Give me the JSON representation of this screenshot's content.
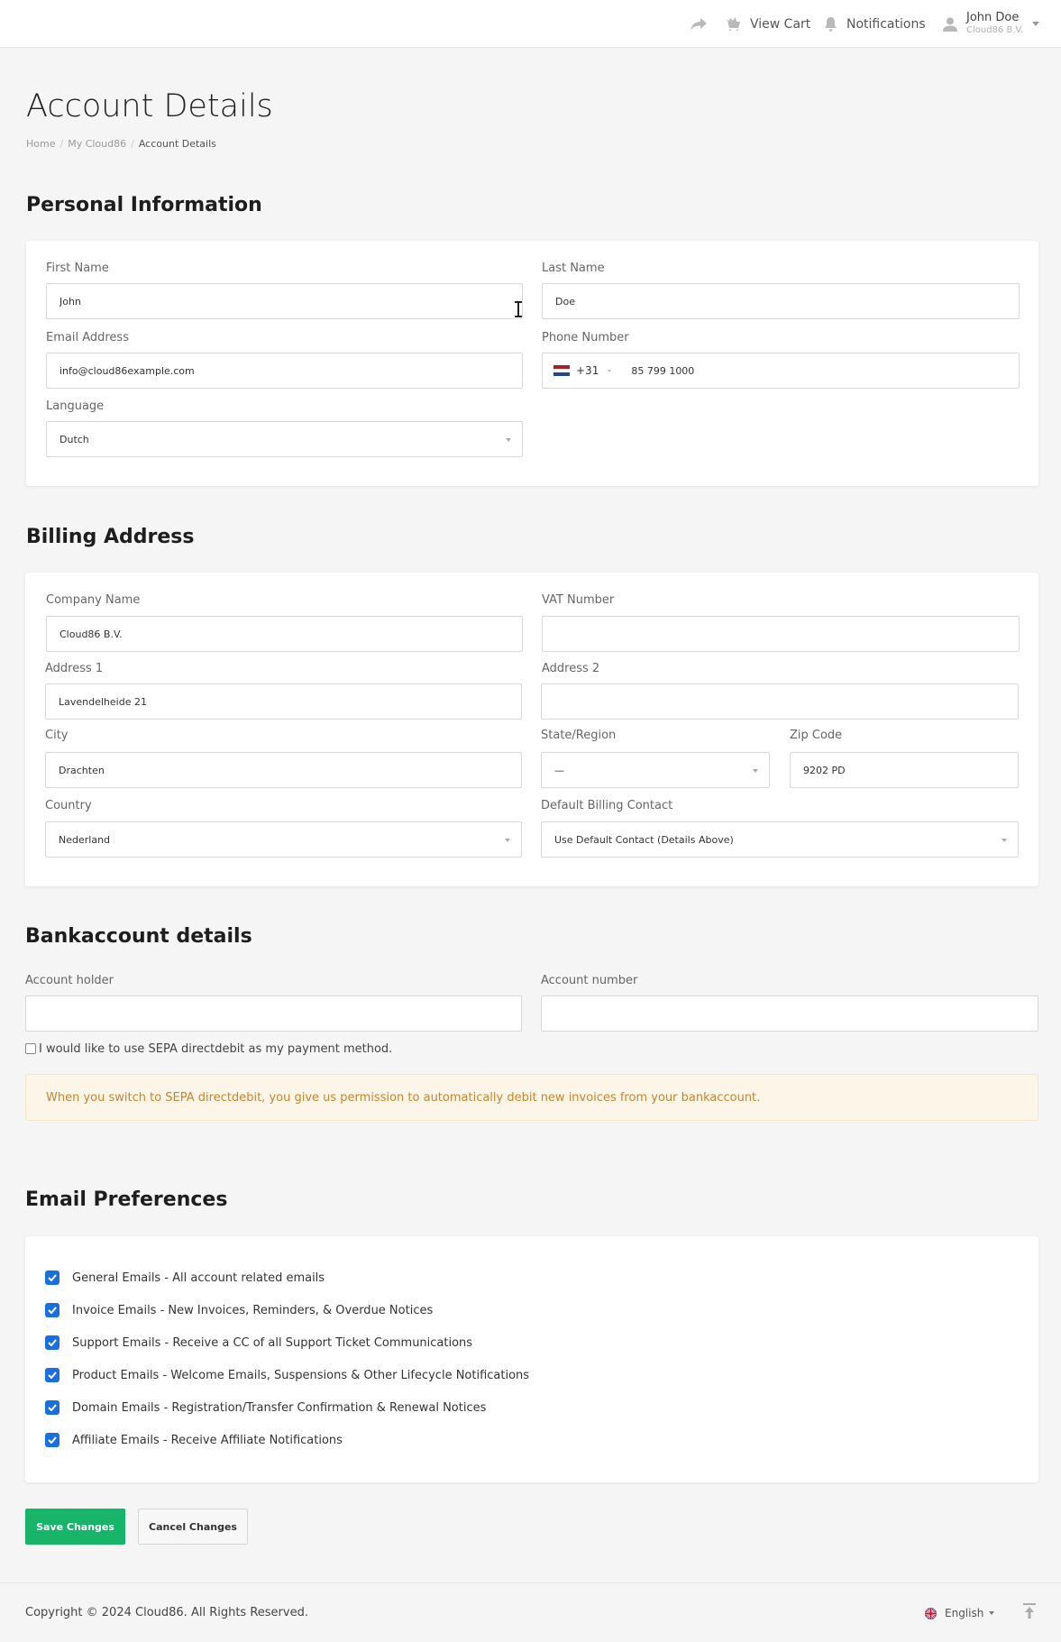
{
  "header": {
    "cart_label": "View Cart",
    "notifications_label": "Notifications",
    "user_name": "John Doe",
    "user_company": "Cloud86 B.V."
  },
  "page": {
    "title": "Account Details",
    "breadcrumb": [
      "Home",
      "My Cloud86",
      "Account Details"
    ]
  },
  "personal": {
    "heading": "Personal Information",
    "first_name_label": "First Name",
    "first_name": "John",
    "last_name_label": "Last Name",
    "last_name": "Doe",
    "email_label": "Email Address",
    "email": "info@cloud86example.com",
    "phone_label": "Phone Number",
    "phone_code": "+31",
    "phone_number": "85 799 1000",
    "language_label": "Language",
    "language": "Dutch"
  },
  "billing": {
    "heading": "Billing Address",
    "company_label": "Company Name",
    "company": "Cloud86 B.V.",
    "vat_label": "VAT Number",
    "vat": "",
    "address1_label": "Address 1",
    "address1": "Lavendelheide 21",
    "address2_label": "Address 2",
    "address2": "",
    "city_label": "City",
    "city": "Drachten",
    "state_label": "State/Region",
    "state": "—",
    "zip_label": "Zip Code",
    "zip": "9202 PD",
    "country_label": "Country",
    "country": "Nederland",
    "contact_label": "Default Billing Contact",
    "contact": "Use Default Contact (Details Above)"
  },
  "bank": {
    "heading": "Bankaccount details",
    "holder_label": "Account holder",
    "holder": "",
    "number_label": "Account number",
    "number": "",
    "sepa_label": "I would like to use SEPA directdebit as my payment method.",
    "notice": "When you switch to SEPA directdebit, you give us permission to automatically debit new invoices from your bankaccount."
  },
  "email_prefs": {
    "heading": "Email Preferences",
    "items": [
      "General Emails - All account related emails",
      "Invoice Emails - New Invoices, Reminders, & Overdue Notices",
      "Support Emails - Receive a CC of all Support Ticket Communications",
      "Product Emails - Welcome Emails, Suspensions & Other Lifecycle Notifications",
      "Domain Emails - Registration/Transfer Confirmation & Renewal Notices",
      "Affiliate Emails - Receive Affiliate Notifications"
    ]
  },
  "actions": {
    "save": "Save Changes",
    "cancel": "Cancel Changes"
  },
  "footer": {
    "copyright": "Copyright © 2024 Cloud86. All Rights Reserved.",
    "language": "English"
  },
  "colors": {
    "accent_green": "#17b46a",
    "checkbox_blue": "#1a6fe0",
    "notice_text": "#c7852c",
    "notice_bg": "#fdf6e8"
  },
  "icons": [
    "share-icon",
    "cart-icon",
    "bell-icon",
    "user-icon",
    "uk-flag-icon",
    "nl-flag-icon",
    "back-to-top-icon"
  ]
}
